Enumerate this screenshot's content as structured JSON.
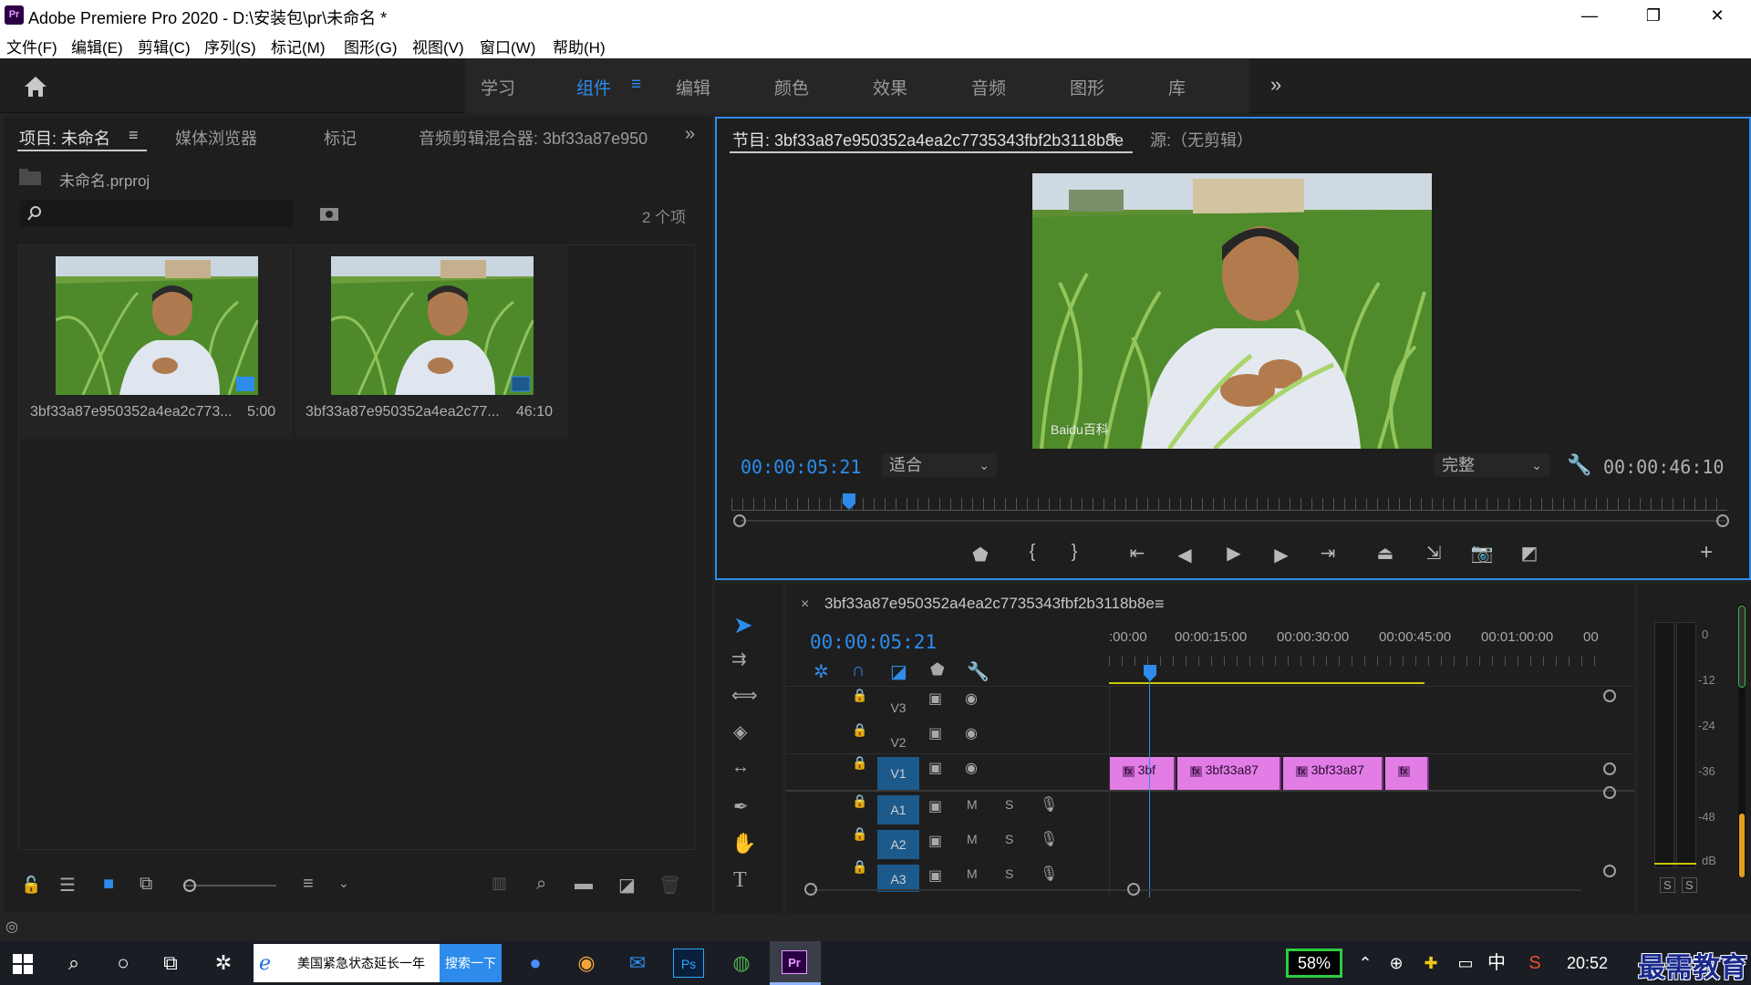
{
  "titlebar": {
    "app_icon": "Pr",
    "title": "Adobe Premiere Pro 2020 - D:\\安装包\\pr\\未命名 *"
  },
  "menu": [
    "文件(F)",
    "编辑(E)",
    "剪辑(C)",
    "序列(S)",
    "标记(M)",
    "图形(G)",
    "视图(V)",
    "窗口(W)",
    "帮助(H)"
  ],
  "workspaces": {
    "tabs": [
      "学习",
      "组件",
      "编辑",
      "颜色",
      "效果",
      "音频",
      "图形",
      "库"
    ],
    "active": "组件",
    "menu_icon": "≡",
    "overflow": "»"
  },
  "project": {
    "tabs": [
      "项目: 未命名",
      "媒体浏览器",
      "标记",
      "音频剪辑混合器: 3bf33a87e950"
    ],
    "file": "未命名.prproj",
    "search_placeholder": "",
    "count": "2 个项",
    "items": [
      {
        "name": "3bf33a87e950352a4ea2c773...",
        "duration": "5:00"
      },
      {
        "name": "3bf33a87e950352a4ea2c77...",
        "duration": "46:10"
      }
    ]
  },
  "program": {
    "tab": "节目: 3bf33a87e950352a4ea2c7735343fbf2b3118b8e",
    "source_tab": "源:（无剪辑）",
    "timecode": "00:00:05:21",
    "zoom": "适合",
    "quality": "完整",
    "duration": "00:00:46:10",
    "video_watermark": "Baidu百科",
    "playhead_fraction": 0.11
  },
  "timeline": {
    "sequence": "3bf33a87e950352a4ea2c7735343fbf2b3118b8e",
    "timecode": "00:00:05:21",
    "ruler": [
      ":00:00",
      "00:00:15:00",
      "00:00:30:00",
      "00:00:45:00",
      "00:01:00:00",
      "00"
    ],
    "video_tracks": [
      "V3",
      "V2",
      "V1"
    ],
    "audio_tracks": [
      "A1",
      "A2",
      "A3"
    ],
    "track_m": "M",
    "track_s": "S",
    "clips": [
      "3bf",
      "3bf33a87",
      "3bf33a87",
      ""
    ],
    "fx_badge": "fx"
  },
  "meter": {
    "scale": [
      "0",
      "-12",
      "-24",
      "-36",
      "-48",
      "dB"
    ],
    "solo": [
      "S",
      "S"
    ]
  },
  "taskbar": {
    "news_text": "美国紧急状态延长一年",
    "search_btn": "搜索一下",
    "battery": "58%",
    "ime": "中",
    "time": "20:52",
    "watermark": "最需教育"
  },
  "colors": {
    "accent": "#2d8ceb",
    "clip": "#e27de6",
    "track_active": "#1c5a8c"
  }
}
